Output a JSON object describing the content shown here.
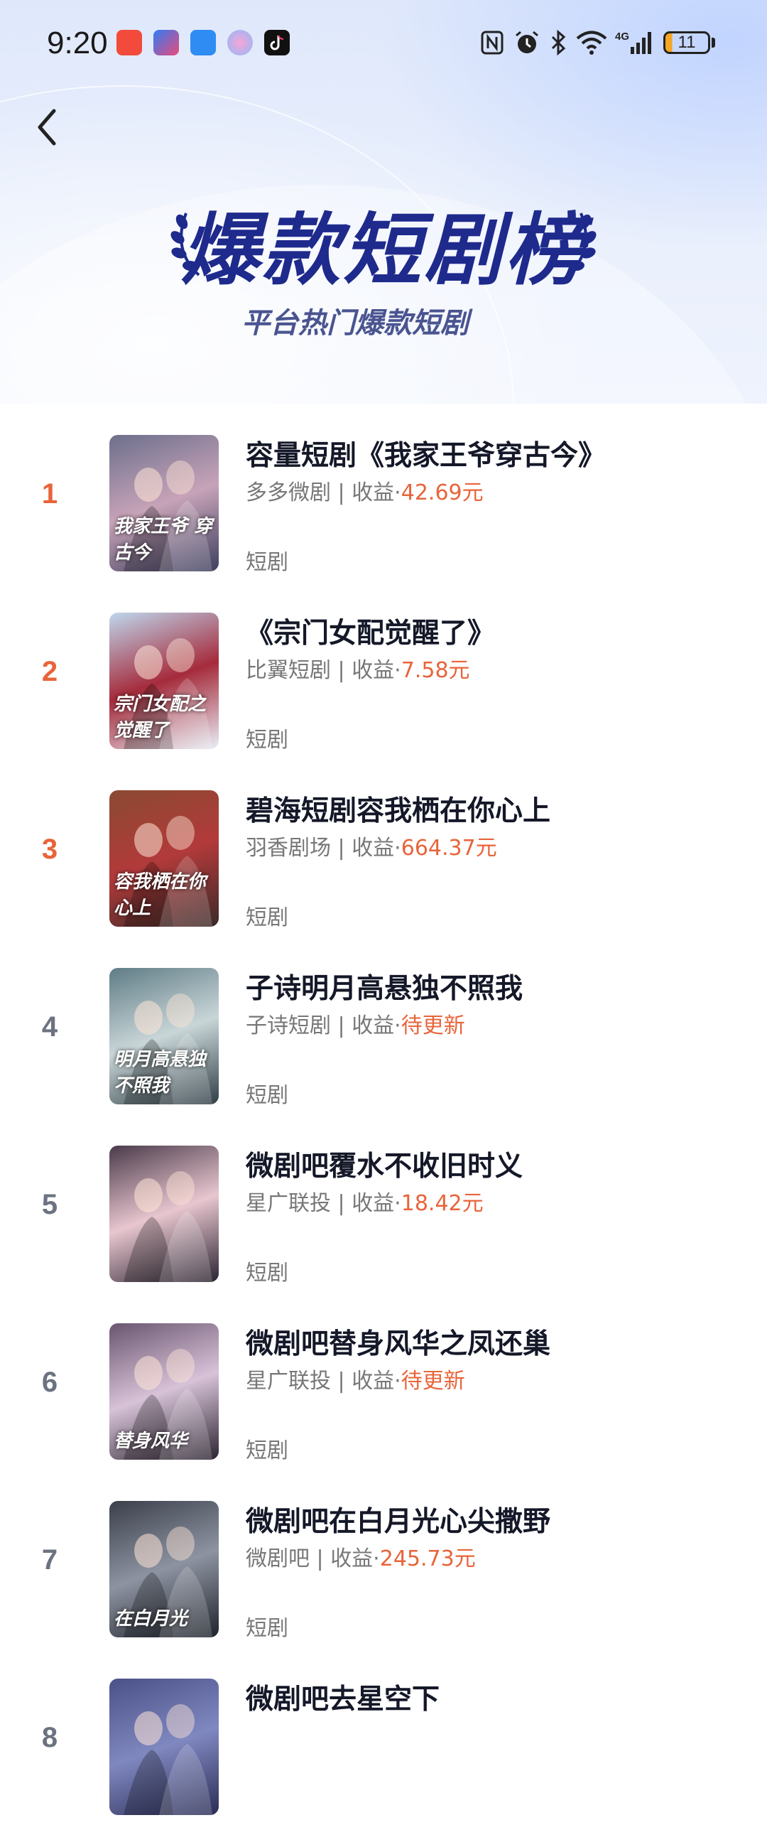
{
  "status_bar": {
    "time": "9:20",
    "battery": "11"
  },
  "header": {
    "title": "爆款短剧榜",
    "subtitle": "平台热门爆款短剧"
  },
  "list": [
    {
      "rank": "1",
      "title": "容量短剧《我家王爷穿古今》",
      "platform": "多多微剧",
      "sep": " | ",
      "income_label": "收益·",
      "income": "42.69元",
      "tag": "短剧",
      "caption": "我家王爷 穿古今",
      "cover_colors": [
        "#6c6f8c",
        "#c7a3b8",
        "#3d3f5e"
      ]
    },
    {
      "rank": "2",
      "title": "《宗门女配觉醒了》",
      "platform": "比翼短剧",
      "sep": " | ",
      "income_label": "收益·",
      "income": "7.58元",
      "tag": "短剧",
      "caption": "宗门女配之觉醒了",
      "cover_colors": [
        "#bfd7ee",
        "#a52b3b",
        "#e9eef6"
      ]
    },
    {
      "rank": "3",
      "title": "碧海短剧容我栖在你心上",
      "platform": "羽香剧场",
      "sep": " | ",
      "income_label": "收益·",
      "income": "664.37元",
      "tag": "短剧",
      "caption": "容我栖在你心上",
      "cover_colors": [
        "#8a4a32",
        "#b23a3a",
        "#3b2a28"
      ]
    },
    {
      "rank": "4",
      "title": "子诗明月高悬独不照我",
      "platform": "子诗短剧",
      "sep": " | ",
      "income_label": "收益·",
      "income": "待更新",
      "tag": "短剧",
      "caption": "明月高悬独不照我",
      "cover_colors": [
        "#5f7c86",
        "#c9d6d8",
        "#2f3e45"
      ]
    },
    {
      "rank": "5",
      "title": "微剧吧覆水不收旧时义",
      "platform": "星广联投",
      "sep": " | ",
      "income_label": "收益·",
      "income": "18.42元",
      "tag": "短剧",
      "caption": "",
      "cover_colors": [
        "#4a3a4a",
        "#e8c6cf",
        "#2a2330"
      ]
    },
    {
      "rank": "6",
      "title": "微剧吧替身风华之凤还巢",
      "platform": "星广联投",
      "sep": " | ",
      "income_label": "收益·",
      "income": "待更新",
      "tag": "短剧",
      "caption": "替身风华",
      "cover_colors": [
        "#6a5570",
        "#d7c2d8",
        "#2c2430"
      ]
    },
    {
      "rank": "7",
      "title": "微剧吧在白月光心尖撒野",
      "platform": "微剧吧",
      "sep": " | ",
      "income_label": "收益·",
      "income": "245.73元",
      "tag": "短剧",
      "caption": "在白月光",
      "cover_colors": [
        "#3a3f4a",
        "#8d93a1",
        "#1f232b"
      ]
    },
    {
      "rank": "8",
      "title": "微剧吧去星空下",
      "platform": "",
      "sep": "",
      "income_label": "",
      "income": "",
      "tag": "",
      "caption": "",
      "cover_colors": [
        "#4a5088",
        "#8088c0",
        "#2a2d55"
      ]
    }
  ]
}
